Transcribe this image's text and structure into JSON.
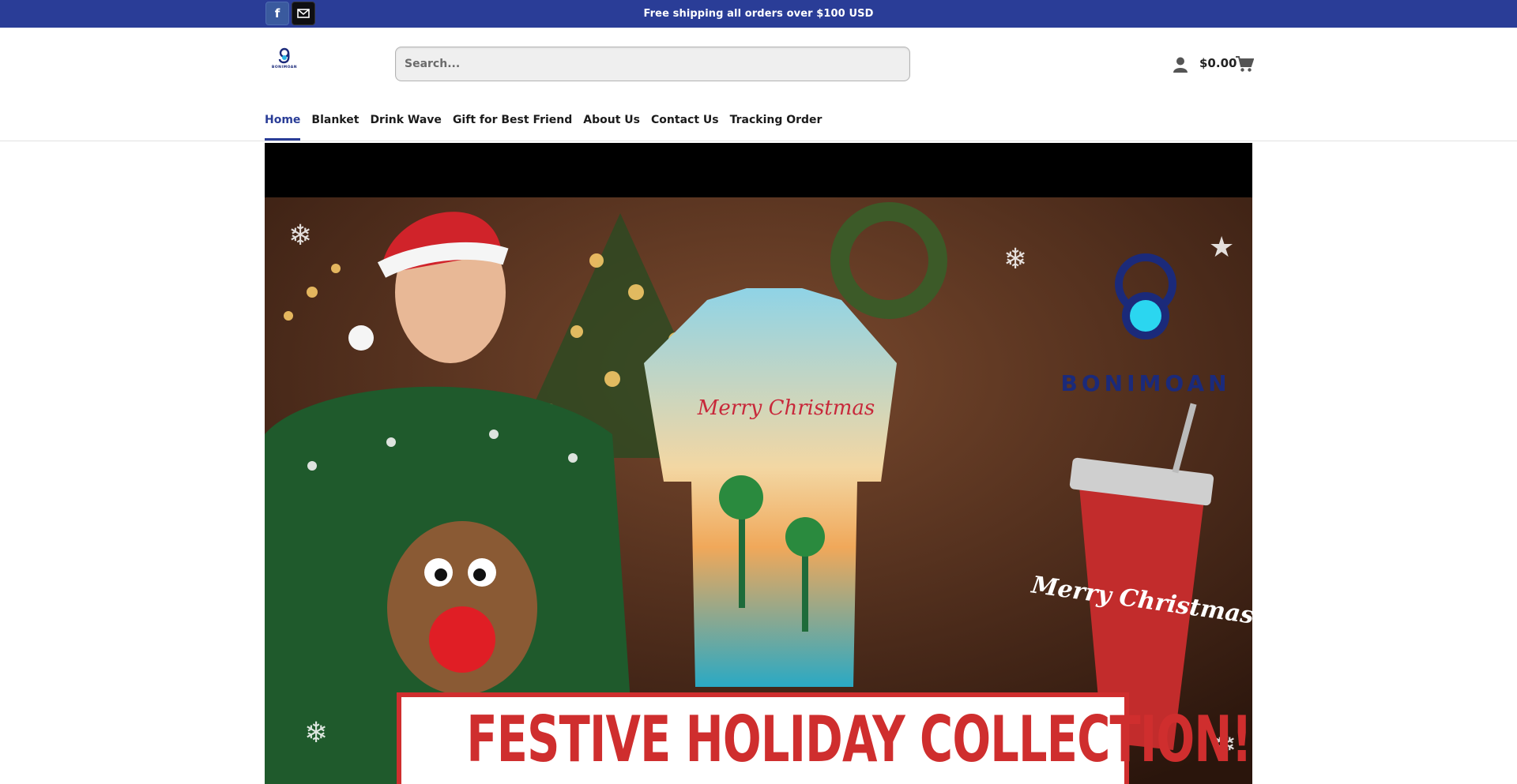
{
  "topbar": {
    "message": "Free shipping all orders over $100 USD",
    "social": [
      {
        "name": "facebook",
        "icon": "facebook-icon",
        "glyph": "f"
      },
      {
        "name": "email",
        "icon": "mail-icon"
      }
    ],
    "background": "#2a3d97"
  },
  "header": {
    "logo_text": "BONIMOAN",
    "search": {
      "placeholder": "Search..."
    },
    "cart_total": "$0.00",
    "icons": [
      "user-icon",
      "cart-icon"
    ]
  },
  "nav": {
    "items": [
      {
        "label": "Home",
        "active": true
      },
      {
        "label": "Blanket",
        "active": false
      },
      {
        "label": "Drink Wave",
        "active": false
      },
      {
        "label": "Gift for Best Friend",
        "active": false
      },
      {
        "label": "About Us",
        "active": false
      },
      {
        "label": "Contact Us",
        "active": false
      },
      {
        "label": "Tracking Order",
        "active": false
      }
    ],
    "accent": "#2a3d97"
  },
  "hero": {
    "brand_text": "BONIMOAN",
    "banner_text": "FESTIVE HOLIDAY COLLECTION!",
    "banner_color": "#cf2e2e",
    "shirt_text": "Merry Christmas",
    "tumbler_text": "Merry Christmas"
  }
}
